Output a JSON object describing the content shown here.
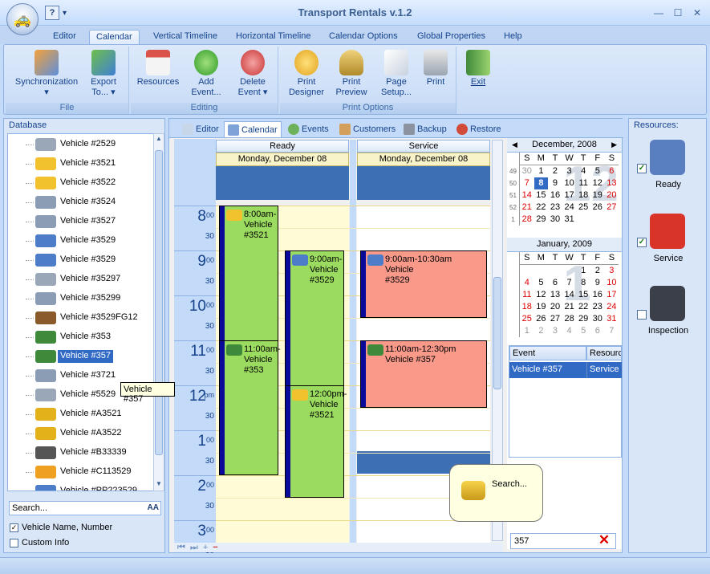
{
  "window": {
    "title": "Transport Rentals v.1.2"
  },
  "qat": {
    "help": "?",
    "dropdown": "▾"
  },
  "window_controls": {
    "minimize": "—",
    "maximize": "☐",
    "close": "✕"
  },
  "ribbon_tabs": [
    "Editor",
    "Calendar",
    "Vertical Timeline",
    "Horizontal Timeline",
    "Calendar Options",
    "Global Properties",
    "Help"
  ],
  "active_ribbon_tab": "Calendar",
  "ribbon": {
    "file_group": {
      "label": "File",
      "sync": "Synchronization",
      "sync_arrow": "▾",
      "export": "Export",
      "export2": "To...",
      "export_arrow": "▾"
    },
    "editing_group": {
      "label": "Editing",
      "resources": "Resources",
      "add": "Add",
      "add2": "Event...",
      "delete": "Delete",
      "delete2": "Event",
      "delete_arrow": "▾"
    },
    "print_group": {
      "label": "Print Options",
      "print_designer": "Print",
      "print_designer2": "Designer",
      "print_preview": "Print",
      "print_preview2": "Preview",
      "page_setup": "Page",
      "page_setup2": "Setup...",
      "print": "Print"
    },
    "exit": "Exit"
  },
  "database": {
    "title": "Database",
    "vehicles": [
      {
        "label": "Vehicle #2529",
        "icon": "bus-icon"
      },
      {
        "label": "Vehicle #3521",
        "icon": "taxi-icon"
      },
      {
        "label": "Vehicle #3522",
        "icon": "taxi-icon"
      },
      {
        "label": "Vehicle #3524",
        "icon": "truck-icon"
      },
      {
        "label": "Vehicle #3527",
        "icon": "truck-icon"
      },
      {
        "label": "Vehicle #3529",
        "icon": "car-icon"
      },
      {
        "label": "Vehicle #3529",
        "icon": "car-icon"
      },
      {
        "label": "Vehicle #35297",
        "icon": "bus-icon"
      },
      {
        "label": "Vehicle #35299",
        "icon": "truck-icon"
      },
      {
        "label": "Vehicle #3529FG12",
        "icon": "lorry-icon"
      },
      {
        "label": "Vehicle #353",
        "icon": "motorcycle-icon"
      },
      {
        "label": "Vehicle #357",
        "icon": "motorcycle-icon"
      },
      {
        "label": "Vehicle #3721",
        "icon": "truck-icon"
      },
      {
        "label": "Vehicle #5529",
        "icon": "bus-icon"
      },
      {
        "label": "Vehicle #A3521",
        "icon": "bulldozer-icon"
      },
      {
        "label": "Vehicle #A3522",
        "icon": "bulldozer-icon"
      },
      {
        "label": "Vehicle #B33339",
        "icon": "bicycle-icon"
      },
      {
        "label": "Vehicle #C113529",
        "icon": "helicopter-icon"
      },
      {
        "label": "Vehicle #PP223529",
        "icon": "car-icon"
      }
    ],
    "selected_index": 11,
    "search_placeholder": "Search...",
    "search_btn": "AA",
    "opt_name": "Vehicle Name, Number",
    "opt_name_checked": true,
    "opt_custom": "Custom Info",
    "opt_custom_checked": false,
    "tooltip": "Vehicle #357"
  },
  "center_tabs": [
    "Editor",
    "Calendar",
    "Events",
    "Customers",
    "Backup",
    "Restore"
  ],
  "active_center_tab": "Calendar",
  "calendar": {
    "columns": [
      {
        "resource": "Ready",
        "date": "Monday, December 08"
      },
      {
        "resource": "Service",
        "date": "Monday, December 08"
      }
    ],
    "hours": [
      {
        "h": "8",
        "s": "00"
      },
      {
        "h": "9",
        "s": "00"
      },
      {
        "h": "10",
        "s": "00"
      },
      {
        "h": "11",
        "s": "00"
      },
      {
        "h": "12",
        "s": "pm"
      },
      {
        "h": "1",
        "s": "00"
      },
      {
        "h": "2",
        "s": "00"
      },
      {
        "h": "3",
        "s": "00"
      }
    ],
    "half": "30",
    "appointments": [
      {
        "time": "8:00am-",
        "title": "Vehicle",
        "num": "#3521",
        "color": "#9bdb5f",
        "icon": "taxi-icon"
      },
      {
        "time": "9:00am-",
        "title": "Vehicle",
        "num": "#3529",
        "color": "#9bdb5f",
        "icon": "car-icon"
      },
      {
        "time": "11:00am-",
        "title": "Vehicle",
        "num": "#353",
        "color": "#9bdb5f",
        "icon": "motorcycle-icon"
      },
      {
        "time": "12:00pm-",
        "title": "Vehicle",
        "num": "#3521",
        "color": "#9bdb5f",
        "icon": "taxi-icon"
      },
      {
        "time": "9:00am-10:30am",
        "title": "Vehicle",
        "num": "#3529",
        "color": "#f8998a",
        "icon": "car-icon"
      },
      {
        "time": "11:00am-12:30pm",
        "title": "Vehicle #357",
        "num": "",
        "color": "#f8998a",
        "icon": "motorcycle-icon"
      }
    ]
  },
  "mini_cal": [
    {
      "title": "December, 2008",
      "watermark": "12",
      "dows": [
        "S",
        "M",
        "T",
        "W",
        "T",
        "F",
        "S"
      ],
      "weeks": [
        {
          "wk": "49",
          "days": [
            "30",
            "1",
            "2",
            "3",
            "4",
            "5",
            "6"
          ]
        },
        {
          "wk": "50",
          "days": [
            "7",
            "8",
            "9",
            "10",
            "11",
            "12",
            "13"
          ]
        },
        {
          "wk": "51",
          "days": [
            "14",
            "15",
            "16",
            "17",
            "18",
            "19",
            "20"
          ]
        },
        {
          "wk": "52",
          "days": [
            "21",
            "22",
            "23",
            "24",
            "25",
            "26",
            "27"
          ]
        },
        {
          "wk": "1",
          "days": [
            "28",
            "29",
            "30",
            "31",
            "",
            "",
            ""
          ]
        }
      ]
    },
    {
      "title": "January, 2009",
      "watermark": "1",
      "dows": [
        "S",
        "M",
        "T",
        "W",
        "T",
        "F",
        "S"
      ],
      "weeks": [
        {
          "wk": "",
          "days": [
            "",
            "",
            "",
            "",
            "1",
            "2",
            "3"
          ]
        },
        {
          "wk": "",
          "days": [
            "4",
            "5",
            "6",
            "7",
            "8",
            "9",
            "10"
          ]
        },
        {
          "wk": "",
          "days": [
            "11",
            "12",
            "13",
            "14",
            "15",
            "16",
            "17"
          ]
        },
        {
          "wk": "",
          "days": [
            "18",
            "19",
            "20",
            "21",
            "22",
            "23",
            "24"
          ]
        },
        {
          "wk": "",
          "days": [
            "25",
            "26",
            "27",
            "28",
            "29",
            "30",
            "31"
          ]
        },
        {
          "wk": "",
          "days": [
            "1",
            "2",
            "3",
            "4",
            "5",
            "6",
            "7"
          ]
        }
      ]
    }
  ],
  "event_table": {
    "headers": [
      "Event",
      "Resource"
    ],
    "row": [
      "Vehicle #357",
      "Service"
    ]
  },
  "event_search": {
    "value": "357",
    "balloon": "Search..."
  },
  "resources": {
    "title": "Resources:",
    "items": [
      {
        "label": "Ready",
        "checked": true,
        "color": "#5a7fc0",
        "icon": "calendar-icon"
      },
      {
        "label": "Service",
        "checked": true,
        "color": "#d9342a",
        "icon": "toolbox-icon"
      },
      {
        "label": "Inspection",
        "checked": false,
        "color": "#3a3f4a",
        "icon": "inspector-icon"
      }
    ]
  },
  "nav": {
    "first": "⏮",
    "last": "⏭",
    "add": "+",
    "remove": "−"
  }
}
